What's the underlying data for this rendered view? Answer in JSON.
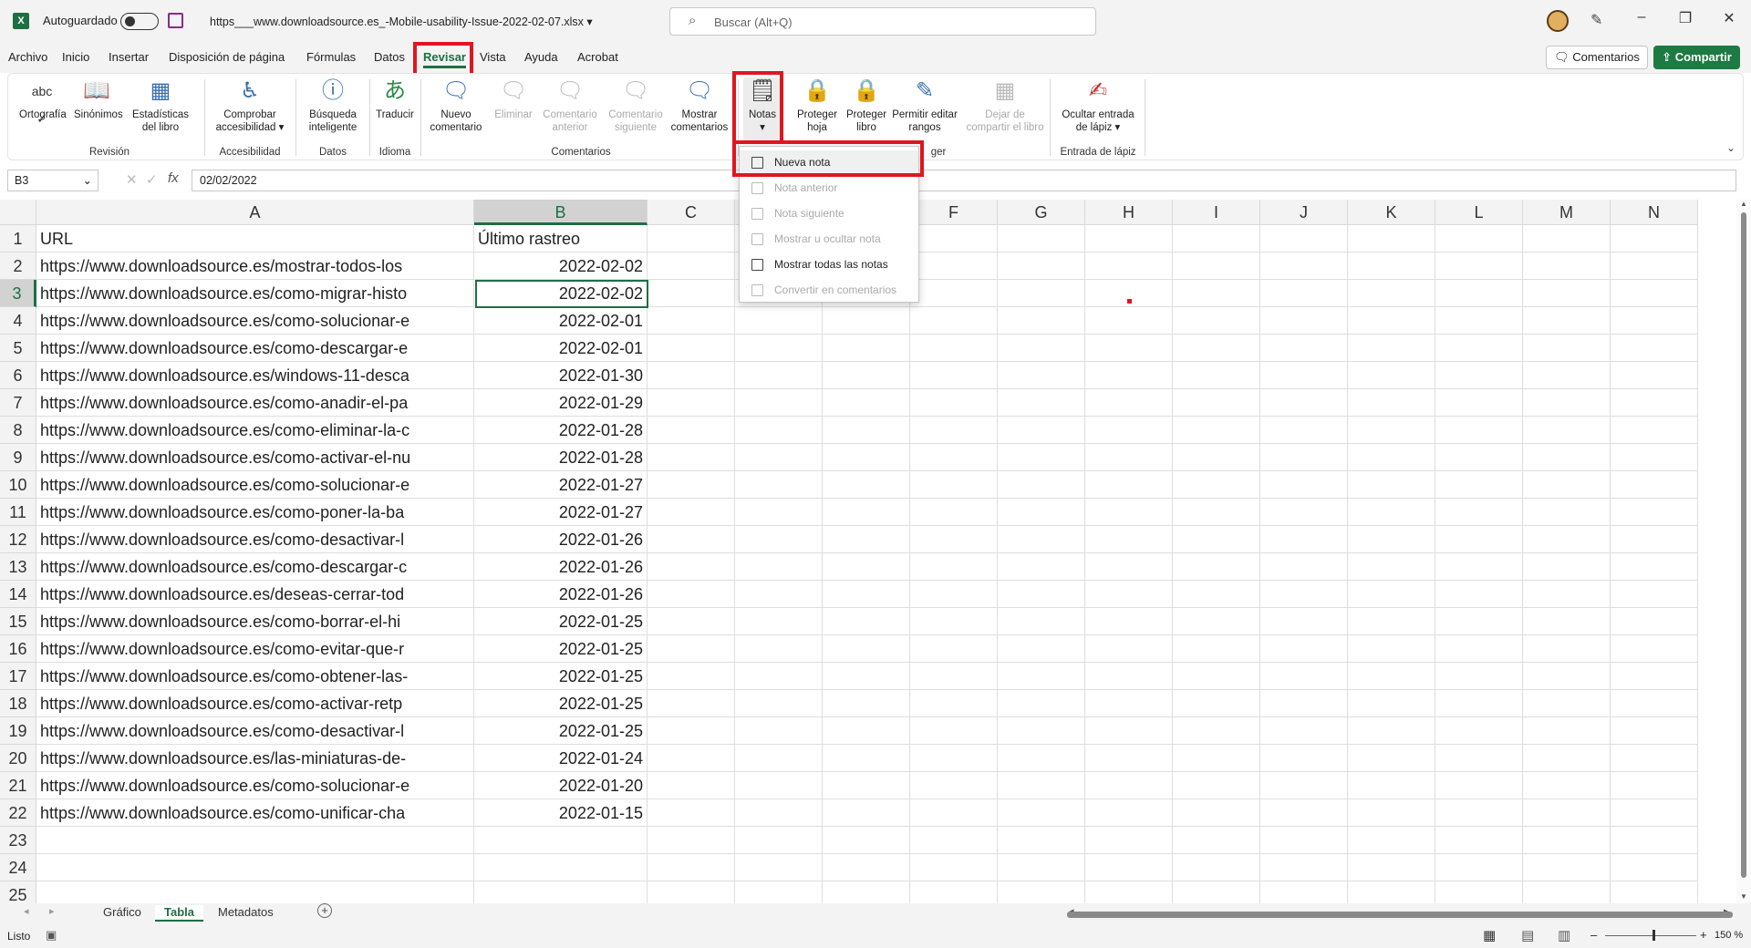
{
  "titlebar": {
    "autosave_label": "Autoguardado",
    "filename": "https___www.downloadsource.es_-Mobile-usability-Issue-2022-02-07.xlsx",
    "search_placeholder": "Buscar (Alt+Q)"
  },
  "menu": {
    "tabs": [
      "Archivo",
      "Inicio",
      "Insertar",
      "Disposición de página",
      "Fórmulas",
      "Datos",
      "Revisar",
      "Vista",
      "Ayuda",
      "Acrobat"
    ],
    "active_tab": "Revisar",
    "comments_button": "Comentarios",
    "share_button": "Compartir"
  },
  "ribbon": {
    "buttons": {
      "ortografia": "Ortografía",
      "sinonimos": "Sinónimos",
      "estadisticas": "Estadísticas del libro",
      "comprobar": "Comprobar accesibilidad",
      "busqueda": "Búsqueda inteligente",
      "traducir": "Traducir",
      "nuevo_comentario": "Nuevo comentario",
      "eliminar": "Eliminar",
      "comentario_anterior": "Comentario anterior",
      "comentario_siguiente": "Comentario siguiente",
      "mostrar_comentarios": "Mostrar comentarios",
      "notas": "Notas",
      "proteger_hoja": "Proteger hoja",
      "proteger_libro": "Proteger libro",
      "permitir_rangos": "Permitir editar rangos",
      "dejar_compartir": "Dejar de compartir el libro",
      "ocultar_lapiz": "Ocultar entrada de lápiz"
    },
    "groups": {
      "revision": "Revisión",
      "accesibilidad": "Accesibilidad",
      "datos": "Datos",
      "idioma": "Idioma",
      "comentarios": "Comentarios",
      "proteger_partial": "ger",
      "lapiz": "Entrada de lápiz"
    }
  },
  "notes_menu": {
    "items": [
      {
        "label": "Nueva nota",
        "enabled": true
      },
      {
        "label": "Nota anterior",
        "enabled": false
      },
      {
        "label": "Nota siguiente",
        "enabled": false
      },
      {
        "label": "Mostrar u ocultar nota",
        "enabled": false
      },
      {
        "label": "Mostrar todas las notas",
        "enabled": true
      },
      {
        "label": "Convertir en comentarios",
        "enabled": false
      }
    ]
  },
  "formula_bar": {
    "name_box": "B3",
    "fx": "fx",
    "formula": "02/02/2022"
  },
  "sheet": {
    "columns": [
      "A",
      "B",
      "C",
      "D",
      "E",
      "F",
      "G",
      "H",
      "I",
      "J",
      "K",
      "L",
      "M",
      "N"
    ],
    "selected_column": "B",
    "selected_row": "3",
    "rows": [
      {
        "n": "1",
        "a": "URL",
        "b": "Último rastreo"
      },
      {
        "n": "2",
        "a": "https://www.downloadsource.es/mostrar-todos-los",
        "b": "2022-02-02"
      },
      {
        "n": "3",
        "a": "https://www.downloadsource.es/como-migrar-histo",
        "b": "2022-02-02"
      },
      {
        "n": "4",
        "a": "https://www.downloadsource.es/como-solucionar-e",
        "b": "2022-02-01"
      },
      {
        "n": "5",
        "a": "https://www.downloadsource.es/como-descargar-e",
        "b": "2022-02-01"
      },
      {
        "n": "6",
        "a": "https://www.downloadsource.es/windows-11-desca",
        "b": "2022-01-30"
      },
      {
        "n": "7",
        "a": "https://www.downloadsource.es/como-anadir-el-pa",
        "b": "2022-01-29"
      },
      {
        "n": "8",
        "a": "https://www.downloadsource.es/como-eliminar-la-c",
        "b": "2022-01-28"
      },
      {
        "n": "9",
        "a": "https://www.downloadsource.es/como-activar-el-nu",
        "b": "2022-01-28"
      },
      {
        "n": "10",
        "a": "https://www.downloadsource.es/como-solucionar-e",
        "b": "2022-01-27"
      },
      {
        "n": "11",
        "a": "https://www.downloadsource.es/como-poner-la-ba",
        "b": "2022-01-27"
      },
      {
        "n": "12",
        "a": "https://www.downloadsource.es/como-desactivar-l",
        "b": "2022-01-26"
      },
      {
        "n": "13",
        "a": "https://www.downloadsource.es/como-descargar-c",
        "b": "2022-01-26"
      },
      {
        "n": "14",
        "a": "https://www.downloadsource.es/deseas-cerrar-tod",
        "b": "2022-01-26"
      },
      {
        "n": "15",
        "a": "https://www.downloadsource.es/como-borrar-el-hi",
        "b": "2022-01-25"
      },
      {
        "n": "16",
        "a": "https://www.downloadsource.es/como-evitar-que-r",
        "b": "2022-01-25"
      },
      {
        "n": "17",
        "a": "https://www.downloadsource.es/como-obtener-las-",
        "b": "2022-01-25"
      },
      {
        "n": "18",
        "a": "https://www.downloadsource.es/como-activar-retp",
        "b": "2022-01-25"
      },
      {
        "n": "19",
        "a": "https://www.downloadsource.es/como-desactivar-l",
        "b": "2022-01-25"
      },
      {
        "n": "20",
        "a": "https://www.downloadsource.es/las-miniaturas-de-",
        "b": "2022-01-24"
      },
      {
        "n": "21",
        "a": "https://www.downloadsource.es/como-solucionar-e",
        "b": "2022-01-20"
      },
      {
        "n": "22",
        "a": "https://www.downloadsource.es/como-unificar-cha",
        "b": "2022-01-15"
      },
      {
        "n": "23",
        "a": "",
        "b": ""
      },
      {
        "n": "24",
        "a": "",
        "b": ""
      },
      {
        "n": "25",
        "a": "",
        "b": ""
      }
    ]
  },
  "sheet_tabs": {
    "tabs": [
      "Gráfico",
      "Tabla",
      "Metadatos"
    ],
    "active": "Tabla"
  },
  "status": {
    "ready": "Listo",
    "zoom": "150 %"
  },
  "colors": {
    "accent": "#1d6f42",
    "highlight_box": "#e0161e"
  }
}
